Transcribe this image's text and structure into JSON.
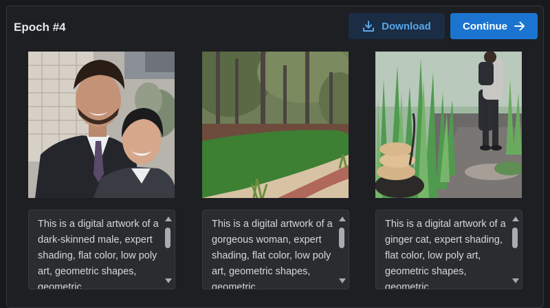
{
  "header": {
    "title": "Epoch #4",
    "download_label": "Download",
    "continue_label": "Continue"
  },
  "icons": {
    "download": "download-icon",
    "continue": "arrow-right-icon"
  },
  "colors": {
    "accent": "#1b75d0",
    "download_bg": "#1a2d45",
    "download_text": "#5aa6ea"
  },
  "images": [
    {
      "caption": "This is a digital artwork of a dark-skinned male, expert shading, flat color, low poly art, geometric shapes, geometric"
    },
    {
      "caption": "This is a digital artwork of a gorgeous woman, expert shading, flat color, low poly art, geometric shapes, geometric"
    },
    {
      "caption": "This is a digital artwork of a ginger cat, expert shading, flat color, low poly art, geometric shapes, geometric"
    }
  ]
}
